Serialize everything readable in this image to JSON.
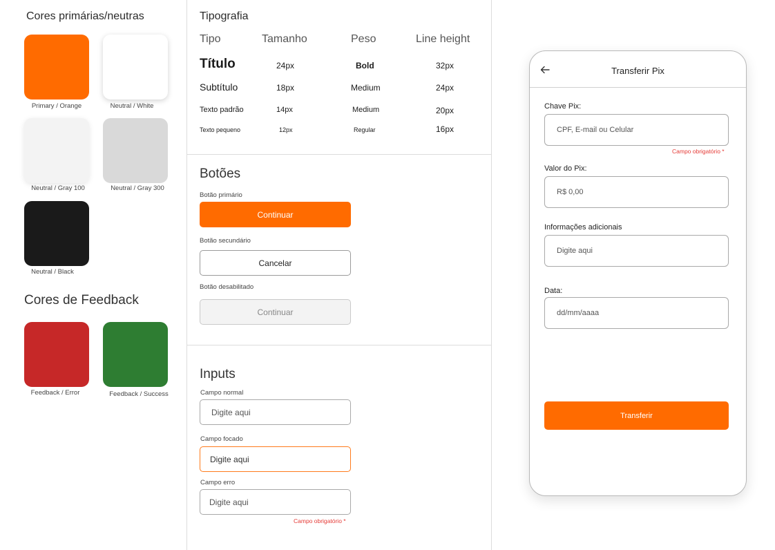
{
  "colors_section": {
    "title": "Cores primárias/neutras",
    "swatches": [
      {
        "label": "Primary / Orange",
        "color": "#FF6B00"
      },
      {
        "label": "Neutral / White",
        "color": "#FFFFFF"
      },
      {
        "label": "Neutral / Gray 100",
        "color": "#F3F3F3"
      },
      {
        "label": "Neutral / Gray 300",
        "color": "#D9D9D9"
      },
      {
        "label": "Neutral / Black",
        "color": "#1A1A1A"
      }
    ]
  },
  "feedback_section": {
    "title": "Cores de Feedback",
    "swatches": [
      {
        "label": "Feedback / Error",
        "color": "#C62828"
      },
      {
        "label": "Feedback / Success",
        "color": "#2E7D32"
      }
    ]
  },
  "typography": {
    "title": "Tipografia",
    "headers": [
      "Tipo",
      "Tamanho",
      "Peso",
      "Line height"
    ],
    "rows": [
      [
        "Título",
        "24px",
        "Bold",
        "32px"
      ],
      [
        "Subtítulo",
        "18px",
        "Medium",
        "24px"
      ],
      [
        "Texto padrão",
        "14px",
        "Medium",
        "20px"
      ],
      [
        "Texto pequeno",
        "12px",
        "Regular",
        "16px"
      ]
    ]
  },
  "buttons": {
    "title": "Botões",
    "primary_label": "Botão primário",
    "primary_text": "Continuar",
    "secondary_label": "Botão secundário",
    "secondary_text": "Cancelar",
    "disabled_label": "Botão desabilitado",
    "disabled_text": "Continuar"
  },
  "inputs": {
    "title": "Inputs",
    "normal_label": "Campo normal",
    "normal_placeholder": "Digite aqui",
    "focused_label": "Campo focado",
    "focused_placeholder": "Digite aqui",
    "error_label": "Campo erro",
    "error_placeholder": "Digite aqui",
    "error_message": "Campo obrigatório *"
  },
  "phone": {
    "title": "Transferir Pix",
    "fields": [
      {
        "label": "Chave Pix:",
        "placeholder": "CPF, E-mail ou Celular",
        "note": "Campo obrigatório *"
      },
      {
        "label": "Valor do Pix:",
        "placeholder": "R$ 0,00"
      },
      {
        "label": "Informações adicionais",
        "placeholder": "Digite aqui"
      },
      {
        "label": "Data:",
        "placeholder": "dd/mm/aaaa"
      }
    ],
    "submit": "Transferir"
  }
}
